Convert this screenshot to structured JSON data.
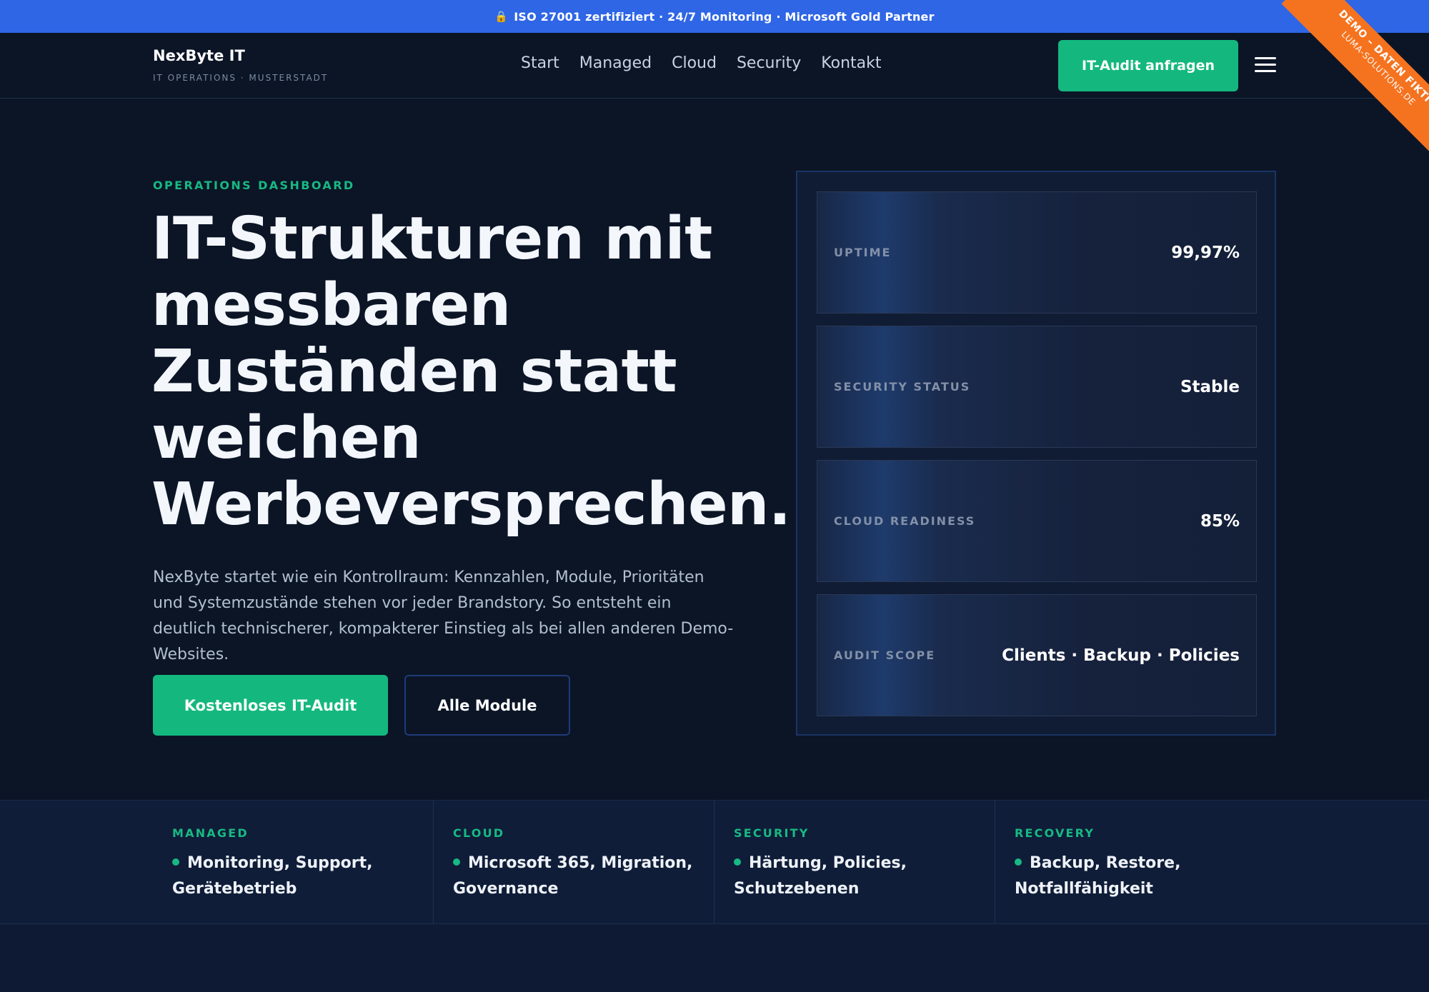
{
  "topbar": {
    "icon": "lock-icon",
    "text": "ISO 27001 zertifiziert · 24/7 Monitoring · Microsoft Gold Partner"
  },
  "header": {
    "brand_name": "NexByte IT",
    "brand_sub": "IT OPERATIONS · MUSTERSTADT",
    "nav": [
      "Start",
      "Managed",
      "Cloud",
      "Security",
      "Kontakt"
    ],
    "cta": "IT-Audit anfragen",
    "menu_icon": "hamburger-menu-icon"
  },
  "ribbon": {
    "line1": "DEMO – DATEN FIKTIV",
    "line2": "LUMA-SOLUTIONS.DE"
  },
  "hero": {
    "eyebrow": "OPERATIONS DASHBOARD",
    "headline": "IT-Strukturen mit messbaren Zuständen statt weichen Werbeversprechen.",
    "lead": "NexByte startet wie ein Kontrollraum: Kennzahlen, Module, Prioritäten und Systemzustände stehen vor jeder Brandstory. So entsteht ein deutlich technischerer, kompakterer Einstieg als bei allen anderen Demo-Websites.",
    "primary_button": "Kostenloses IT-Audit",
    "secondary_button": "Alle Module"
  },
  "panel": {
    "metrics": [
      {
        "label": "UPTIME",
        "value": "99,97%"
      },
      {
        "label": "SECURITY STATUS",
        "value": "Stable"
      },
      {
        "label": "CLOUD READINESS",
        "value": "85%"
      },
      {
        "label": "AUDIT SCOPE",
        "value": "Clients · Backup · Policies"
      }
    ]
  },
  "modules": [
    {
      "label": "MANAGED",
      "text": "Monitoring, Support, Gerätebetrieb"
    },
    {
      "label": "CLOUD",
      "text": "Microsoft 365, Migration, Governance"
    },
    {
      "label": "SECURITY",
      "text": "Härtung, Policies, Schutzebenen"
    },
    {
      "label": "RECOVERY",
      "text": "Backup, Restore, Notfallfähigkeit"
    }
  ],
  "colors": {
    "accent": "#14b87f",
    "topbar": "#2f66e6",
    "ribbon": "#f5731f",
    "background": "#0b1526"
  }
}
